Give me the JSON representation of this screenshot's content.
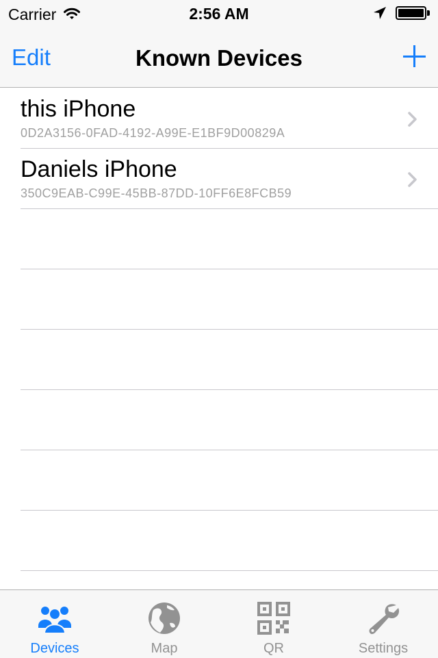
{
  "status_bar": {
    "carrier": "Carrier",
    "time": "2:56 AM"
  },
  "nav": {
    "edit_label": "Edit",
    "title": "Known Devices",
    "add_icon": "plus-icon"
  },
  "devices": [
    {
      "name": "this iPhone",
      "uuid": "0D2A3156-0FAD-4192-A99E-E1BF9D00829A"
    },
    {
      "name": "Daniels iPhone",
      "uuid": "350C9EAB-C99E-45BB-87DD-10FF6E8FCB59"
    }
  ],
  "tabs": [
    {
      "label": "Devices",
      "icon": "people-icon",
      "active": true
    },
    {
      "label": "Map",
      "icon": "globe-icon",
      "active": false
    },
    {
      "label": "QR",
      "icon": "qr-code-icon",
      "active": false
    },
    {
      "label": "Settings",
      "icon": "wrench-icon",
      "active": false
    }
  ],
  "colors": {
    "accent": "#157efb",
    "inactive_tab": "#929292",
    "subtitle": "#a0a0a0",
    "bar_background": "#f7f7f7",
    "separator": "#c8c7cc"
  }
}
